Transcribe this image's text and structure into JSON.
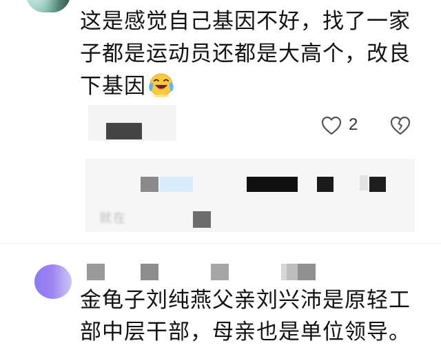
{
  "first_comment": {
    "lines": [
      "这是感觉自己基因不好，找了一家",
      "子都是运动员还都是大高个，改良",
      "下基因"
    ],
    "emoji": "laughing-crying-face",
    "like_count": "2",
    "icons": {
      "like": "heart-outline-icon",
      "dislike": "broken-heart-icon"
    },
    "reply_preview": "就在"
  },
  "second_comment": {
    "lines": [
      "金龟子刘纯燕父亲刘兴沛是原轻工",
      "部中层干部，母亲也是单位领导。"
    ]
  },
  "colors": {
    "text": "#111111",
    "meta": "#333333",
    "background": "#ffffff",
    "redaction": "#3a3a3a",
    "reply_bg": "#f6f6f6",
    "avatar2_accent": "#8b7cf0"
  }
}
